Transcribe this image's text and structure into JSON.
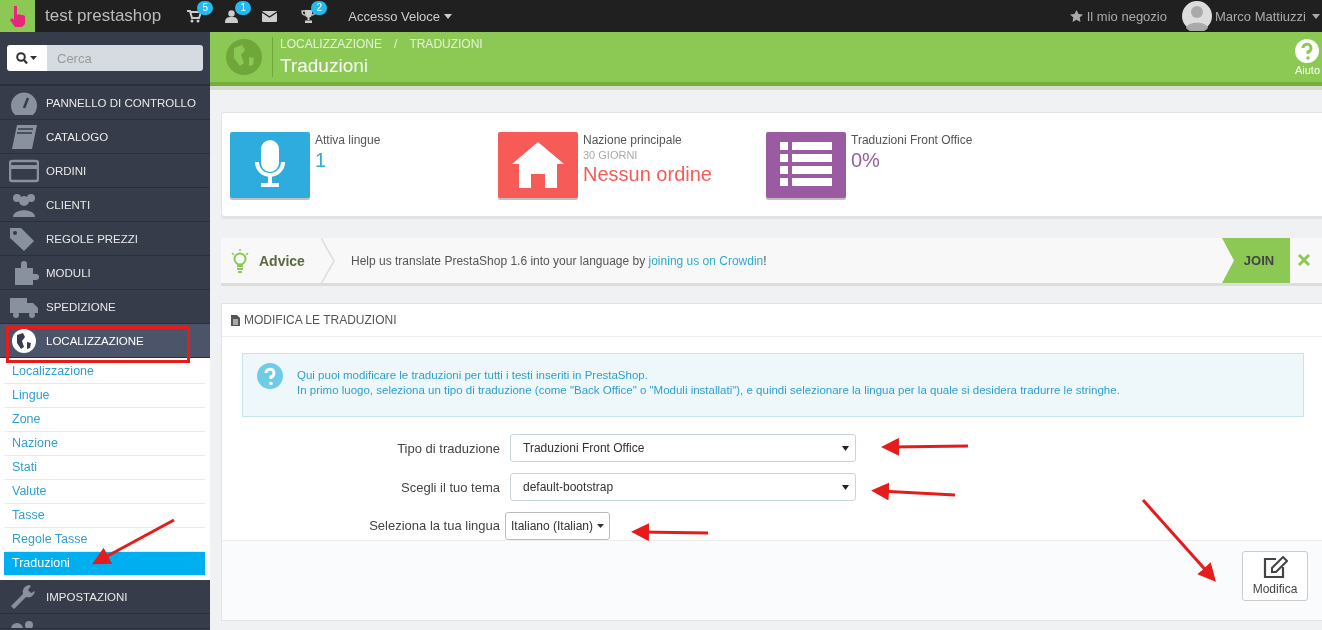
{
  "topbar": {
    "shop_name": "test prestashop",
    "badges": [
      {
        "kind": "cart",
        "count": "5"
      },
      {
        "kind": "user",
        "count": "1"
      },
      {
        "kind": "mail"
      },
      {
        "kind": "trophy",
        "count": "2"
      }
    ],
    "quick_access": "Accesso Veloce",
    "shop_link": "Il mio negozio",
    "user_name": "Marco Mattiuzzi"
  },
  "sidebar": {
    "search_placeholder": "Cerca",
    "items": [
      {
        "label": "PANNELLO DI CONTROLLO",
        "selected": false
      },
      {
        "label": "CATALOGO",
        "selected": false
      },
      {
        "label": "ORDINI",
        "selected": false
      },
      {
        "label": "CLIENTI",
        "selected": false
      },
      {
        "label": "REGOLE PREZZI",
        "selected": false
      },
      {
        "label": "MODULI",
        "selected": false
      },
      {
        "label": "SPEDIZIONE",
        "selected": false
      },
      {
        "label": "LOCALIZZAZIONE",
        "selected": true,
        "children": [
          {
            "label": "Localizzazione",
            "selected": false
          },
          {
            "label": "Lingue",
            "selected": false
          },
          {
            "label": "Zone",
            "selected": false
          },
          {
            "label": "Nazione",
            "selected": false
          },
          {
            "label": "Stati",
            "selected": false
          },
          {
            "label": "Valute",
            "selected": false
          },
          {
            "label": "Tasse",
            "selected": false
          },
          {
            "label": "Regole Tasse",
            "selected": false
          },
          {
            "label": "Traduzioni",
            "selected": true
          }
        ]
      },
      {
        "label": "IMPOSTAZIONI",
        "selected": false
      }
    ]
  },
  "header": {
    "breadcrumb": [
      "LOCALIZZAZIONE",
      "TRADUZIONI"
    ],
    "breadcrumb_separator": "/",
    "title": "Traduzioni",
    "help": "Aiuto"
  },
  "kpis": [
    {
      "label": "Attiva lingue",
      "value": "1",
      "color": "#2eacde"
    },
    {
      "label": "Nazione principale",
      "sublabel": "30 GIORNI",
      "value": "Nessun ordine",
      "color": "#f65b57"
    },
    {
      "label": "Traduzioni Front Office",
      "value": "0%",
      "color": "#9a5ba2"
    }
  ],
  "advice": {
    "title": "Advice",
    "text": "Help us translate PrestaShop 1.6 into your language by",
    "link": "joining us on Crowdin",
    "after": "!",
    "button": "JOIN"
  },
  "panel": {
    "heading": "MODIFICA LE TRADUZIONI",
    "info": [
      "Qui puoi modificare le traduzioni per tutti i testi inseriti in PrestaShop.",
      "In primo luogo, seleziona un tipo di traduzione (come \"Back Office\" o \"Moduli installati\"), e quindi selezionare la lingua per la quale si desidera tradurre le stringhe."
    ],
    "fields": [
      {
        "kind": "select",
        "label": "Tipo di traduzione",
        "value": "Traduzioni Front Office"
      },
      {
        "kind": "select",
        "label": "Scegli il tuo tema",
        "value": "default-bootstrap"
      },
      {
        "kind": "dropdown",
        "label": "Seleziona la tua lingua",
        "value": "Italiano (Italian)"
      }
    ],
    "button": "Modifica"
  }
}
